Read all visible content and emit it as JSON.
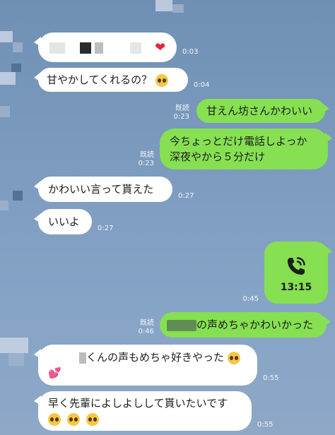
{
  "colors": {
    "incoming_bubble": "#ffffff",
    "outgoing_bubble": "#86e052",
    "background": "#7b9abe"
  },
  "messages": [
    {
      "direction": "incoming",
      "text_visible": "",
      "icon": "red-heart-emoji",
      "time": "0:03",
      "note_redacted": true
    },
    {
      "direction": "incoming",
      "text": "甘やかしてくれるの？",
      "icon": "pleading-face-emoji",
      "time": "0:04"
    },
    {
      "direction": "outgoing",
      "text": "甘えん坊さんかわいい",
      "read": "既読",
      "time": "0:23"
    },
    {
      "direction": "outgoing",
      "line1": "今ちょっとだけ電話しよっか",
      "line2": "深夜やから５分だけ",
      "read": "既読",
      "time": "0:23"
    },
    {
      "direction": "incoming",
      "text": "かわいい言って貰えた",
      "time": "0:27"
    },
    {
      "direction": "incoming",
      "text": "いいよ",
      "time": "0:27"
    },
    {
      "direction": "outgoing",
      "type": "call",
      "icon": "phone-call-icon",
      "duration": "13:15",
      "time": "0:45"
    },
    {
      "direction": "outgoing",
      "text": "の声めちゃかわいかった",
      "read": "既読",
      "time": "0:46"
    },
    {
      "direction": "incoming",
      "text": "くんの声もめちゃ好きやった",
      "icons": [
        "pleading-face-emoji",
        "two-hearts-emoji"
      ],
      "time": "0:55"
    },
    {
      "direction": "incoming",
      "text": "早く先輩によしよしして貰いたいです",
      "icons": [
        "pleading-face-emoji",
        "pleading-face-emoji",
        "pleading-face-emoji"
      ],
      "time": "0:55"
    }
  ]
}
